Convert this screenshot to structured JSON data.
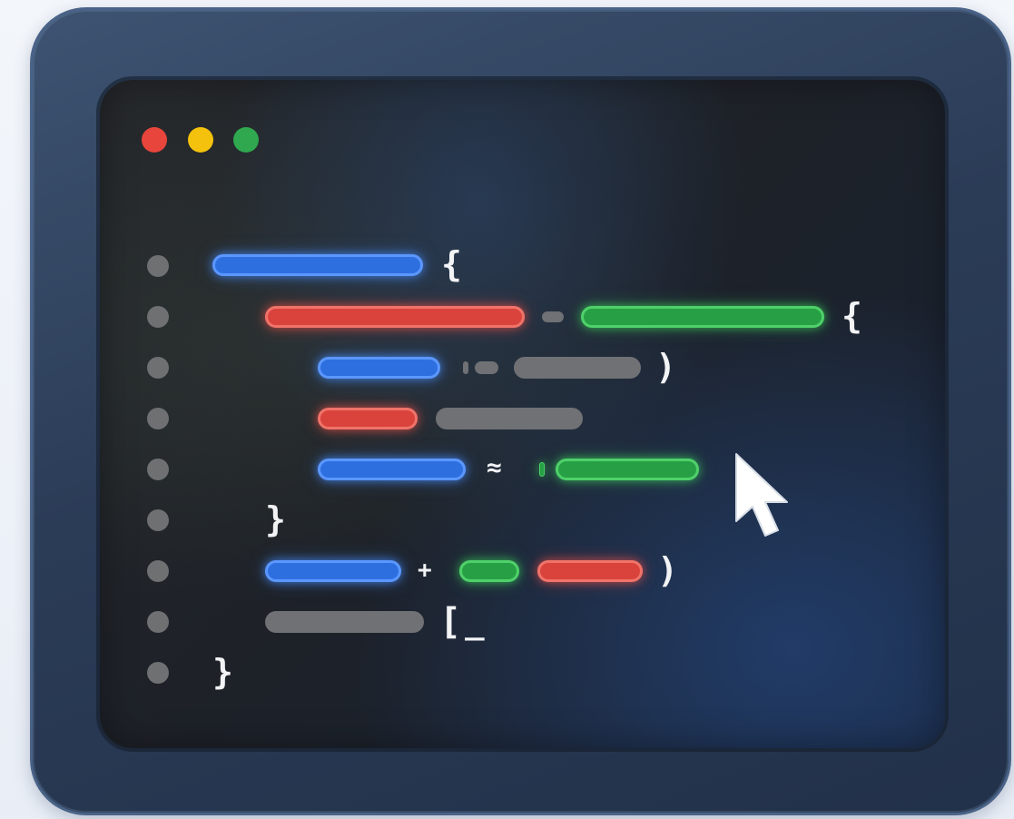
{
  "window_controls": {
    "close_color": "#e8453c",
    "minimize_color": "#f4c20d",
    "maximize_color": "#2fa84f"
  },
  "code_symbols": {
    "line1_open": "{",
    "line2_open": "{",
    "line3_close": ")",
    "line5_op": "≈",
    "line6_close": "}",
    "line7_plus": "+",
    "line7_close": ")",
    "line8_bracket": "[",
    "line8_caret": "_",
    "line9_close": "}"
  },
  "token_colors": {
    "keyword": "#2e6fe0",
    "string": "#d9433b",
    "value": "#27a045",
    "neutral": "#6f7174"
  },
  "icons": [
    "mouse-pointer-icon"
  ]
}
